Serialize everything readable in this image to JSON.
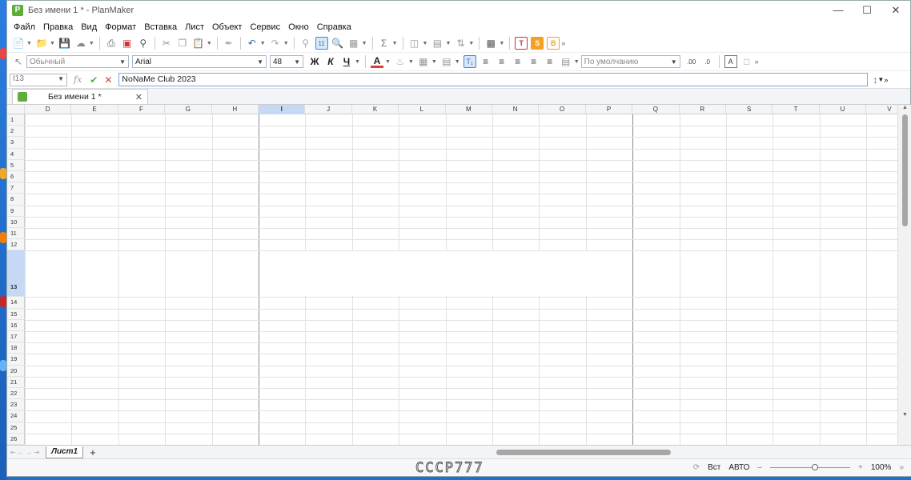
{
  "window": {
    "title": "Без имени 1 * - PlanMaker",
    "app_icon_letter": "P"
  },
  "menu": [
    "Файл",
    "Правка",
    "Вид",
    "Формат",
    "Вставка",
    "Лист",
    "Объект",
    "Сервис",
    "Окно",
    "Справка"
  ],
  "format_toolbar": {
    "style": "Обычный",
    "font": "Arial",
    "font_size": "48",
    "bold": "Ж",
    "italic": "К",
    "underline": "Ч",
    "default_combo": "По умолчанию"
  },
  "formula_bar": {
    "cell_ref": "I13",
    "fx": "fx",
    "value": "NoNaMe Club 2023"
  },
  "doc_tab": {
    "label": "Без имени 1 *"
  },
  "columns": [
    "D",
    "E",
    "F",
    "G",
    "H",
    "I",
    "J",
    "K",
    "L",
    "M",
    "N",
    "O",
    "P",
    "Q",
    "R",
    "S",
    "T",
    "U",
    "V"
  ],
  "selected_column": "I",
  "rows": [
    "1",
    "2",
    "3",
    "4",
    "5",
    "6",
    "7",
    "8",
    "9",
    "10",
    "11",
    "12",
    "13",
    "14",
    "15",
    "16",
    "17",
    "18",
    "19",
    "20",
    "21",
    "22",
    "23",
    "24",
    "25",
    "26"
  ],
  "selected_row": "13",
  "sheet": {
    "name": "Лист1",
    "add": "+"
  },
  "status": {
    "logo": "CCCP777",
    "mode": "Вст",
    "calc": "АВТО",
    "zoom": "100%"
  }
}
